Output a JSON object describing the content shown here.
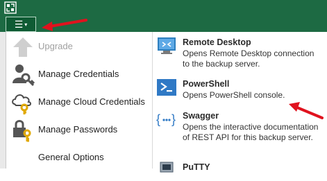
{
  "colors": {
    "titlebar": "#1d6a43",
    "arrow": "#e0121e",
    "menu_button": "#0f5b34"
  },
  "menu_button": {
    "icon": "hamburger-icon",
    "caret": "▾"
  },
  "left_menu": [
    {
      "label": "Upgrade",
      "icon": "upgrade-arrow-icon",
      "disabled": true
    },
    {
      "label": "Manage Credentials",
      "icon": "credentials-key-icon",
      "disabled": false
    },
    {
      "label": "Manage Cloud Credentials",
      "icon": "cloud-key-icon",
      "disabled": false
    },
    {
      "label": "Manage Passwords",
      "icon": "password-lock-icon",
      "disabled": false
    },
    {
      "label": "General Options",
      "icon": "",
      "disabled": false
    }
  ],
  "right_menu": [
    {
      "title": "Remote Desktop",
      "description": "Opens Remote Desktop connection to the backup server.",
      "icon": "remote-desktop-icon"
    },
    {
      "title": "PowerShell",
      "description": "Opens PowerShell console.",
      "icon": "powershell-icon"
    },
    {
      "title": "Swagger",
      "description": "Opens the interactive documentation of REST API for this backup server.",
      "icon": "swagger-icon"
    },
    {
      "title": "PuTTY",
      "description": "",
      "icon": "putty-icon"
    }
  ]
}
